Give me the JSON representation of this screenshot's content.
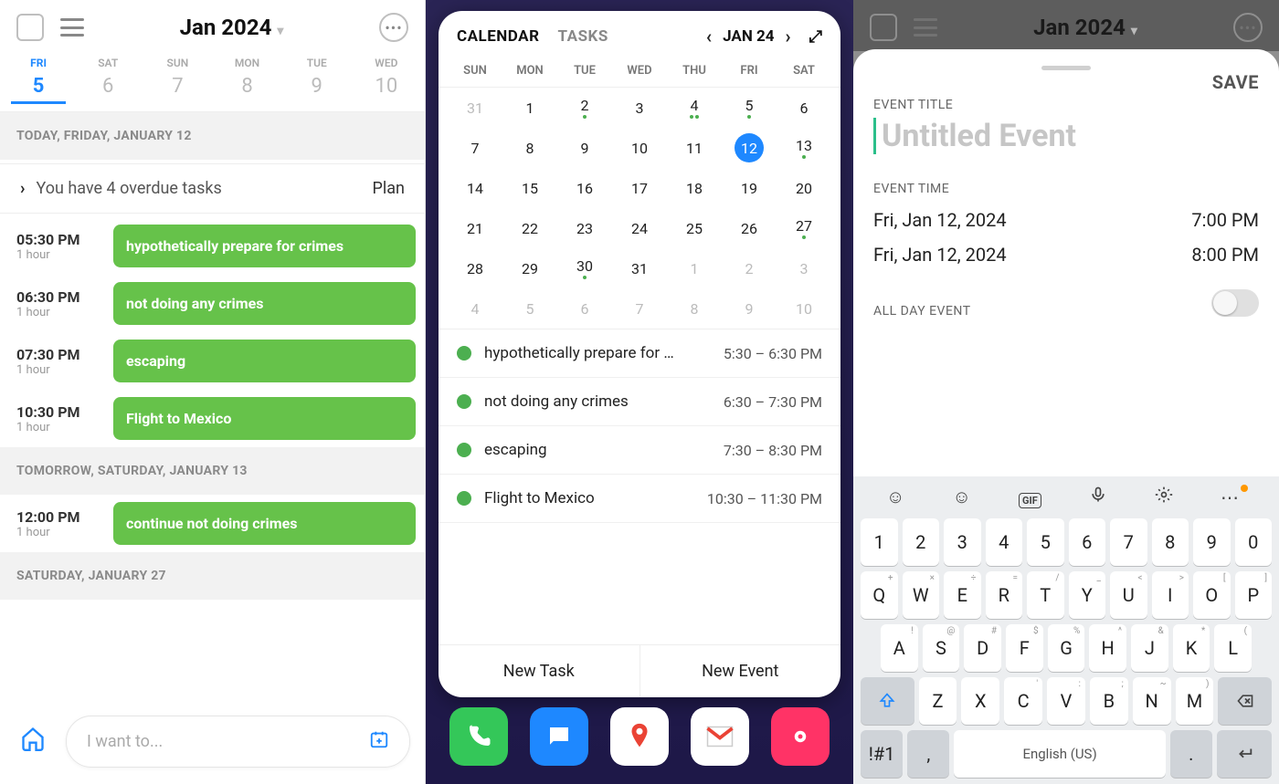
{
  "panel1": {
    "title": "Jan 2024",
    "week": [
      {
        "dow": "FRI",
        "num": "5",
        "selected": true
      },
      {
        "dow": "SAT",
        "num": "6"
      },
      {
        "dow": "SUN",
        "num": "7"
      },
      {
        "dow": "MON",
        "num": "8"
      },
      {
        "dow": "TUE",
        "num": "9"
      },
      {
        "dow": "WED",
        "num": "10"
      }
    ],
    "today_header": "TODAY, FRIDAY, JANUARY 12",
    "overdue": {
      "text": "You have 4 overdue tasks",
      "action": "Plan"
    },
    "today_events": [
      {
        "time": "05:30 PM",
        "dur": "1 hour",
        "title": "hypothetically prepare for crimes"
      },
      {
        "time": "06:30 PM",
        "dur": "1 hour",
        "title": "not doing any crimes"
      },
      {
        "time": "07:30 PM",
        "dur": "1 hour",
        "title": "escaping"
      },
      {
        "time": "10:30 PM",
        "dur": "1 hour",
        "title": "Flight to Mexico"
      }
    ],
    "tomorrow_header": "TOMORROW, SATURDAY, JANUARY 13",
    "tomorrow_events": [
      {
        "time": "12:00 PM",
        "dur": "1 hour",
        "title": "continue not doing crimes"
      }
    ],
    "later_header": "SATURDAY, JANUARY 27",
    "input_placeholder": "I want to..."
  },
  "panel2": {
    "tabs": {
      "calendar": "CALENDAR",
      "tasks": "TASKS"
    },
    "current": "JAN 24",
    "dow": [
      "SUN",
      "MON",
      "TUE",
      "WED",
      "THU",
      "FRI",
      "SAT"
    ],
    "grid": [
      [
        {
          "n": "31",
          "o": true
        },
        {
          "n": "1"
        },
        {
          "n": "2",
          "d": 1
        },
        {
          "n": "3"
        },
        {
          "n": "4",
          "d": 2
        },
        {
          "n": "5",
          "d": 1
        },
        {
          "n": "6"
        }
      ],
      [
        {
          "n": "7"
        },
        {
          "n": "8"
        },
        {
          "n": "9"
        },
        {
          "n": "10"
        },
        {
          "n": "11"
        },
        {
          "n": "12",
          "sel": true
        },
        {
          "n": "13",
          "d": 1
        }
      ],
      [
        {
          "n": "14"
        },
        {
          "n": "15"
        },
        {
          "n": "16"
        },
        {
          "n": "17"
        },
        {
          "n": "18"
        },
        {
          "n": "19"
        },
        {
          "n": "20"
        }
      ],
      [
        {
          "n": "21"
        },
        {
          "n": "22"
        },
        {
          "n": "23"
        },
        {
          "n": "24"
        },
        {
          "n": "25"
        },
        {
          "n": "26"
        },
        {
          "n": "27",
          "d": 1
        }
      ],
      [
        {
          "n": "28"
        },
        {
          "n": "29"
        },
        {
          "n": "30",
          "d": 1
        },
        {
          "n": "31"
        },
        {
          "n": "1",
          "o": true
        },
        {
          "n": "2",
          "o": true
        },
        {
          "n": "3",
          "o": true
        }
      ],
      [
        {
          "n": "4",
          "o": true
        },
        {
          "n": "5",
          "o": true
        },
        {
          "n": "6",
          "o": true
        },
        {
          "n": "7",
          "o": true
        },
        {
          "n": "8",
          "o": true
        },
        {
          "n": "9",
          "o": true
        },
        {
          "n": "10",
          "o": true
        }
      ]
    ],
    "events": [
      {
        "title": "hypothetically prepare for …",
        "time": "5:30 – 6:30 PM"
      },
      {
        "title": "not doing any crimes",
        "time": "6:30 – 7:30 PM"
      },
      {
        "title": "escaping",
        "time": "7:30 – 8:30 PM"
      },
      {
        "title": "Flight to Mexico",
        "time": "10:30 – 11:30 PM"
      }
    ],
    "new_task": "New Task",
    "new_event": "New Event"
  },
  "panel3": {
    "bg_title": "Jan 2024",
    "save": "SAVE",
    "title_label": "EVENT TITLE",
    "title_placeholder": "Untitled Event",
    "time_label": "EVENT TIME",
    "start_date": "Fri, Jan 12, 2024",
    "start_time": "7:00 PM",
    "end_date": "Fri, Jan 12, 2024",
    "end_time": "8:00 PM",
    "allday_label": "ALL DAY EVENT",
    "keyboard": {
      "row1": [
        "1",
        "2",
        "3",
        "4",
        "5",
        "6",
        "7",
        "8",
        "9",
        "0"
      ],
      "row2": [
        [
          "Q",
          "+"
        ],
        [
          "W",
          "×"
        ],
        [
          "E",
          "÷"
        ],
        [
          "R",
          "="
        ],
        [
          "T",
          "/"
        ],
        [
          "Y",
          "_"
        ],
        [
          "U",
          "<"
        ],
        [
          "I",
          ">"
        ],
        [
          "O",
          "["
        ],
        [
          "P",
          "]"
        ]
      ],
      "row3": [
        [
          "A",
          "!"
        ],
        [
          "S",
          "@"
        ],
        [
          "D",
          "#"
        ],
        [
          "F",
          "$"
        ],
        [
          "G",
          "%"
        ],
        [
          "H",
          "^"
        ],
        [
          "J",
          "&"
        ],
        [
          "K",
          "*"
        ],
        [
          "L",
          "("
        ]
      ],
      "row4": [
        [
          "Z",
          ""
        ],
        [
          "X",
          ""
        ],
        [
          "C",
          "'"
        ],
        [
          "V",
          ":"
        ],
        [
          "B",
          ";"
        ],
        [
          "N",
          "~"
        ],
        [
          "M",
          ")"
        ]
      ],
      "sym": "!#1",
      "comma": ",",
      "space": "English (US)",
      "period": "."
    }
  }
}
